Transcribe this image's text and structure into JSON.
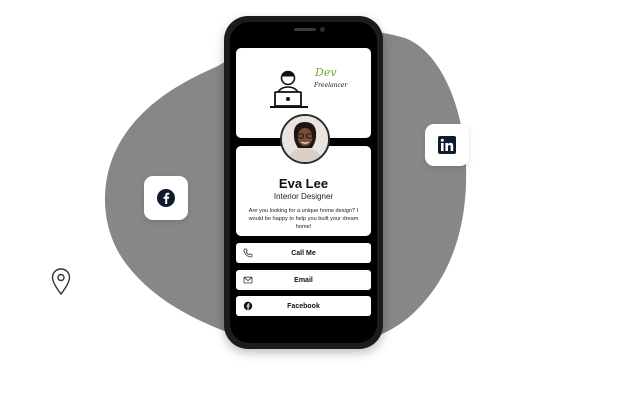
{
  "colors": {
    "blob": "#878787",
    "phone_frame": "#1c1c1e",
    "screen_background": "#000000",
    "card": "#ffffff",
    "logo_accent": "#7aa33a",
    "icon_dark": "#0f1a2e"
  },
  "floating_icons": {
    "left": {
      "icon": "facebook-icon"
    },
    "right": {
      "icon": "linkedin-icon"
    },
    "pin": {
      "icon": "location-pin-icon"
    }
  },
  "logo": {
    "script_top": "Dev",
    "script_bottom": "Freelancer",
    "icon": "developer-at-laptop-icon"
  },
  "profile": {
    "name": "Eva Lee",
    "title": "Interior Designer",
    "bio": "Are you looking for a unique home design? I would be happy to help you built your dream home!",
    "avatar_icon": "profile-photo"
  },
  "actions": [
    {
      "label": "Call Me",
      "icon": "phone-icon"
    },
    {
      "label": "Email",
      "icon": "mail-icon"
    },
    {
      "label": "Facebook",
      "icon": "facebook-icon"
    }
  ]
}
